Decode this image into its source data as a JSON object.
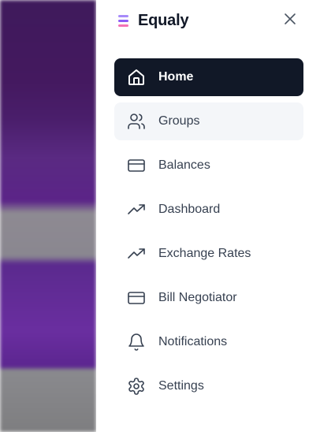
{
  "app": {
    "name": "Equaly",
    "logo_colors": [
      "#a78bfa",
      "#8b5cf6",
      "#f472b6"
    ]
  },
  "nav": {
    "items": [
      {
        "label": "Home",
        "icon": "home-icon",
        "active": true
      },
      {
        "label": "Groups",
        "icon": "users-icon",
        "hover": true
      },
      {
        "label": "Balances",
        "icon": "credit-card-icon"
      },
      {
        "label": "Dashboard",
        "icon": "trending-up-icon"
      },
      {
        "label": "Exchange Rates",
        "icon": "trending-up-icon"
      },
      {
        "label": "Bill Negotiator",
        "icon": "credit-card-icon"
      },
      {
        "label": "Notifications",
        "icon": "bell-icon"
      },
      {
        "label": "Settings",
        "icon": "gear-icon"
      }
    ]
  },
  "colors": {
    "active_bg": "#111827",
    "text": "#374151"
  }
}
